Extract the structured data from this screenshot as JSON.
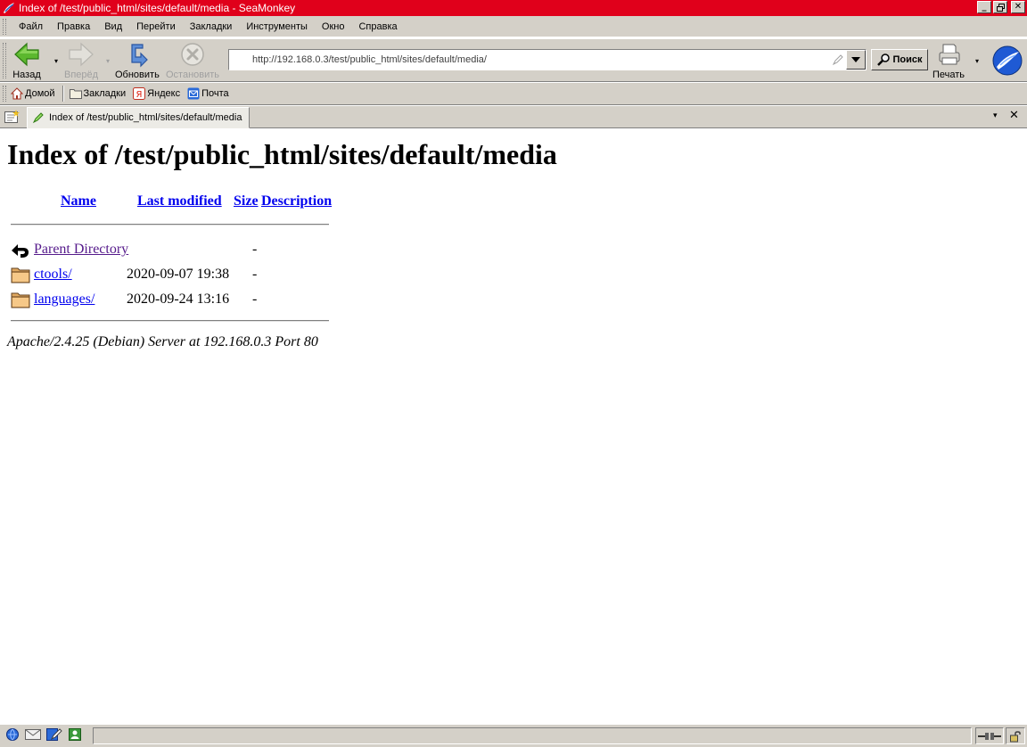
{
  "window": {
    "title": "Index of /test/public_html/sites/default/media - SeaMonkey"
  },
  "menubar": {
    "items": [
      {
        "label": "Файл"
      },
      {
        "label": "Правка"
      },
      {
        "label": "Вид"
      },
      {
        "label": "Перейти"
      },
      {
        "label": "Закладки"
      },
      {
        "label": "Инструменты"
      },
      {
        "label": "Окно"
      },
      {
        "label": "Справка"
      }
    ]
  },
  "navbar": {
    "back": "Назад",
    "forward": "Вперёд",
    "reload": "Обновить",
    "stop": "Остановить",
    "url": "http://192.168.0.3/test/public_html/sites/default/media/",
    "search": "Поиск",
    "print": "Печать"
  },
  "personalbar": {
    "home": "Домой",
    "bookmarks": "Закладки",
    "yandex": "Яндекс",
    "mail": "Почта"
  },
  "tab": {
    "title": "Index of /test/public_html/sites/default/media"
  },
  "page": {
    "title": "Index of /test/public_html/sites/default/media",
    "columns": {
      "name": "Name",
      "modified": "Last modified",
      "size": "Size",
      "description": "Description"
    },
    "rows": [
      {
        "name": "Parent Directory",
        "modified": "",
        "size": "-"
      },
      {
        "name": "ctools/",
        "modified": "2020-09-07 19:38",
        "size": "-"
      },
      {
        "name": "languages/",
        "modified": "2020-09-24 13:16",
        "size": "-"
      }
    ],
    "address": "Apache/2.4.25 (Debian) Server at 192.168.0.3 Port 80"
  },
  "colors": {
    "titlebar": "#e0001b",
    "chrome": "#d4d0c8",
    "link": "#0000ee",
    "visited": "#551a8b"
  },
  "icons": {
    "back": "green-left-arrow-icon",
    "forward": "right-arrow-icon",
    "reload": "reload-icon",
    "stop": "stop-icon",
    "folder": "folder-icon",
    "parent": "back-arrow-icon"
  }
}
